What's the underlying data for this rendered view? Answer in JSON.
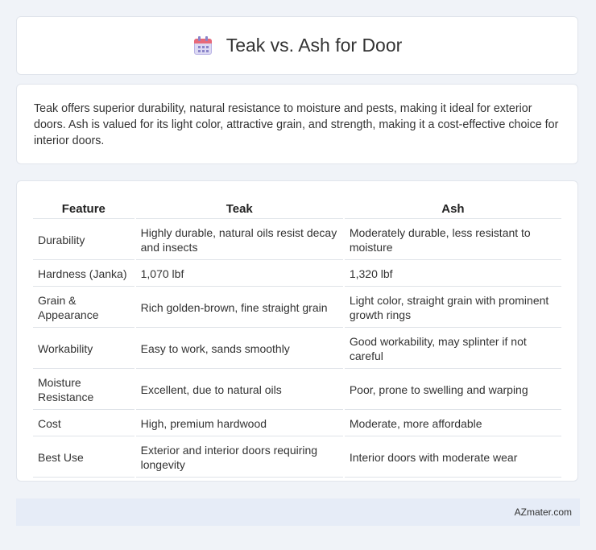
{
  "header": {
    "title": "Teak vs. Ash for Door",
    "icon": "calendar-icon"
  },
  "summary": "Teak offers superior durability, natural resistance to moisture and pests, making it ideal for exterior doors. Ash is valued for its light color, attractive grain, and strength, making it a cost-effective choice for interior doors.",
  "table": {
    "headers": [
      "Feature",
      "Teak",
      "Ash"
    ],
    "rows": [
      [
        "Durability",
        "Highly durable, natural oils resist decay and insects",
        "Moderately durable, less resistant to moisture"
      ],
      [
        "Hardness (Janka)",
        "1,070 lbf",
        "1,320 lbf"
      ],
      [
        "Grain & Appearance",
        "Rich golden-brown, fine straight grain",
        "Light color, straight grain with prominent growth rings"
      ],
      [
        "Workability",
        "Easy to work, sands smoothly",
        "Good workability, may splinter if not careful"
      ],
      [
        "Moisture Resistance",
        "Excellent, due to natural oils",
        "Poor, prone to swelling and warping"
      ],
      [
        "Cost",
        "High, premium hardwood",
        "Moderate, more affordable"
      ],
      [
        "Best Use",
        "Exterior and interior doors requiring longevity",
        "Interior doors with moderate wear"
      ]
    ]
  },
  "footer": {
    "brand": "AZmater.com"
  }
}
